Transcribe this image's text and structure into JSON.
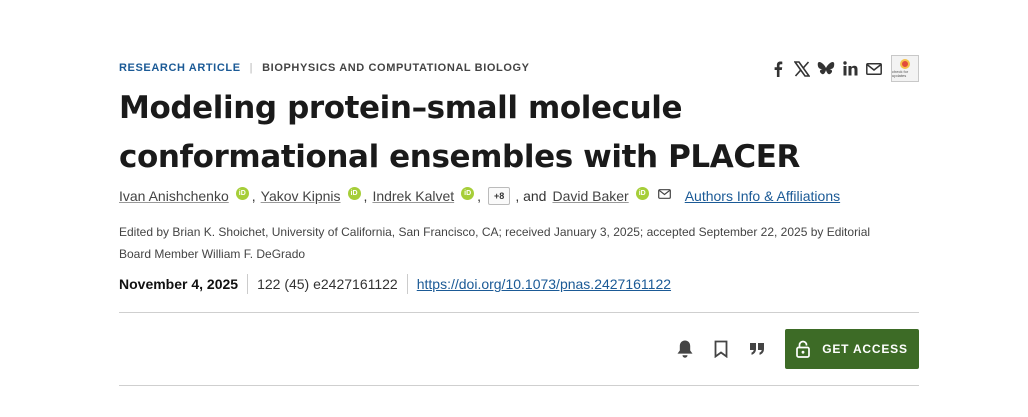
{
  "header": {
    "article_type": "RESEARCH ARTICLE",
    "separator": "|",
    "section": "BIOPHYSICS AND COMPUTATIONAL BIOLOGY"
  },
  "share": {
    "icons": [
      "facebook-icon",
      "x-icon",
      "bluesky-icon",
      "linkedin-icon",
      "email-icon"
    ],
    "crossmark_text": "check for updates"
  },
  "title": "Modeling protein–small molecule conformational ensembles with PLACER",
  "authors": {
    "list": [
      {
        "name": "Ivan Anishchenko",
        "orcid": "iD"
      },
      {
        "name": "Yakov Kipnis",
        "orcid": "iD"
      },
      {
        "name": "Indrek Kalvet",
        "orcid": "iD"
      }
    ],
    "comma": ",",
    "more_label": "+8",
    "and_label": ", and",
    "last": {
      "name": "David Baker",
      "orcid": "iD"
    },
    "affiliations_label": "Authors Info & Affiliations"
  },
  "edited_by": "Edited by Brian K. Shoichet, University of California, San Francisco, CA; received January 3, 2025; accepted September 22, 2025 by Editorial Board Member William F. DeGrado",
  "publication": {
    "date": "November 4, 2025",
    "volume": "122 (45) e2427161122",
    "doi": "https://doi.org/10.1073/pnas.2427161122"
  },
  "actions": {
    "icons": [
      "bell-icon",
      "bookmark-icon",
      "quote-icon"
    ],
    "access_label": "GET ACCESS"
  },
  "colors": {
    "link": "#1b5a96",
    "access_button": "#3d6b26",
    "orcid": "#a6ce39"
  }
}
